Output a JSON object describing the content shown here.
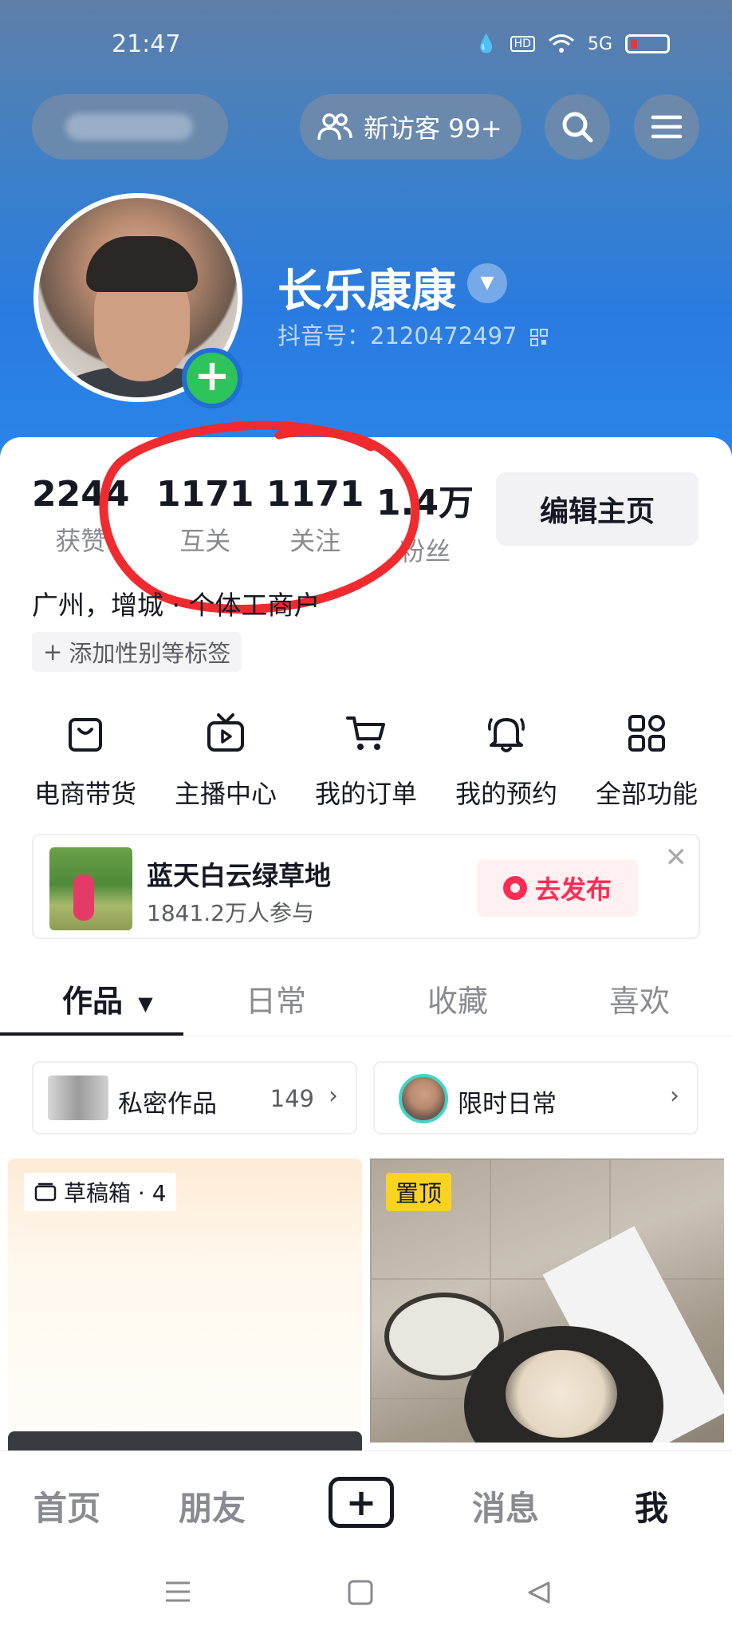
{
  "status_bar": {
    "time": "21:47",
    "hd": "HD",
    "network": "5G"
  },
  "top_bar": {
    "visitor_label": "新访客 99+"
  },
  "profile": {
    "nickname": "长乐康康",
    "douyin_id": "抖音号：2120472497",
    "location": "广州，增城 · 个体工商户",
    "add_tags": "添加性别等标签"
  },
  "stats": [
    {
      "value": "2244",
      "label": "获赞"
    },
    {
      "value": "1171",
      "label": "互关"
    },
    {
      "value": "1171",
      "label": "关注"
    },
    {
      "value": "1.4万",
      "label": "粉丝"
    }
  ],
  "edit_button": "编辑主页",
  "functions": [
    {
      "label": "电商带货",
      "icon": "shopping-bag-icon"
    },
    {
      "label": "主播中心",
      "icon": "tv-play-icon"
    },
    {
      "label": "我的订单",
      "icon": "cart-icon"
    },
    {
      "label": "我的预约",
      "icon": "bell-icon"
    },
    {
      "label": "全部功能",
      "icon": "apps-grid-icon"
    }
  ],
  "topic": {
    "title": "蓝天白云绿草地",
    "participants": "1841.2万人参与",
    "action": "去发布"
  },
  "tabs": [
    "作品",
    "日常",
    "收藏",
    "喜欢"
  ],
  "private_works": {
    "label": "私密作品",
    "count": "149"
  },
  "limited_daily": {
    "label": "限时日常"
  },
  "draft_box": {
    "label": "草稿箱 · 4"
  },
  "pinned_badge": "置顶",
  "bottom_nav": {
    "home": "首页",
    "friends": "朋友",
    "messages": "消息",
    "me": "我"
  },
  "colors": {
    "accent": "#fe2c55",
    "header_blue": "#2a7be0",
    "pin_yellow": "#fad320",
    "add_green": "#2ec35b"
  }
}
